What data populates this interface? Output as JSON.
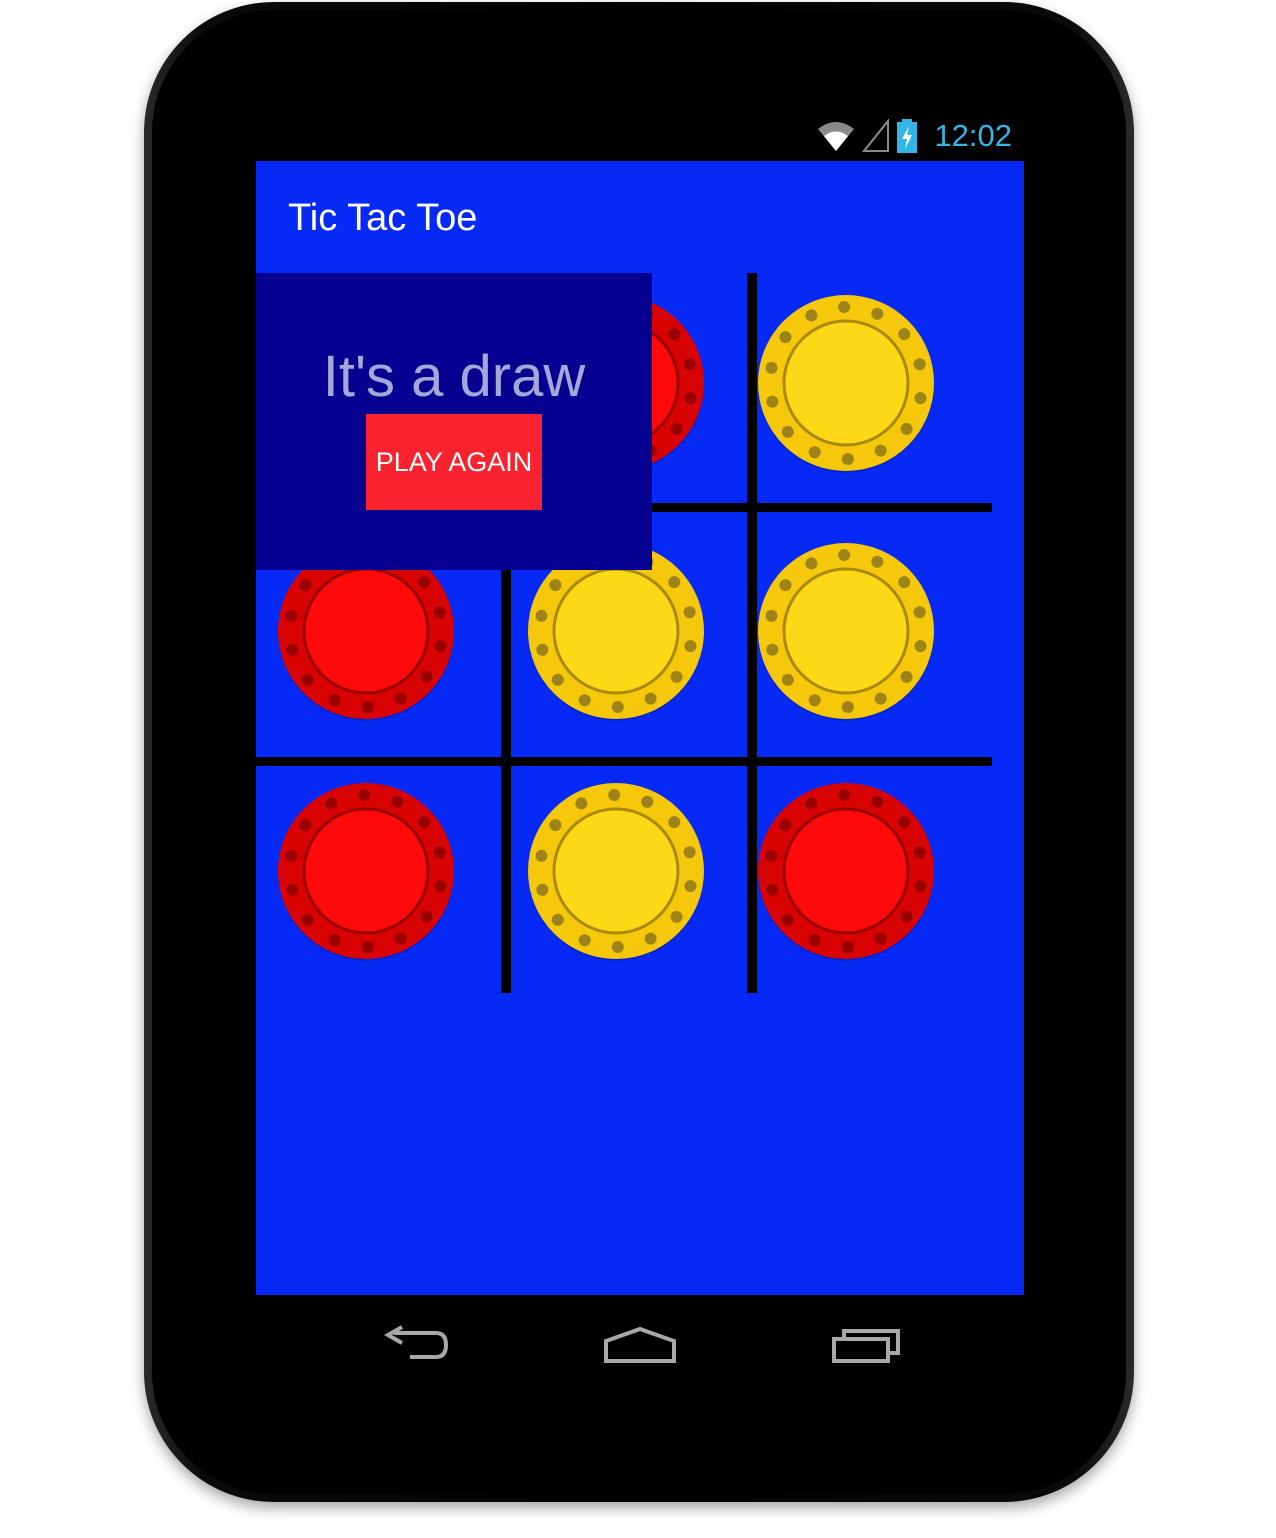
{
  "status_bar": {
    "time": "12:02",
    "icons": [
      "wifi-icon",
      "cell-signal-icon",
      "battery-charging-icon"
    ],
    "clock_color": "#33b5e5"
  },
  "app": {
    "title": "Tic Tac Toe",
    "background_color": "#0629f5"
  },
  "board": {
    "rows": [
      [
        "red",
        "red",
        "yellow"
      ],
      [
        "red",
        "yellow",
        "yellow"
      ],
      [
        "red",
        "yellow",
        "red"
      ]
    ],
    "colors": {
      "red": "#ff0a0a",
      "yellow": "#fdd816"
    }
  },
  "result_dialog": {
    "message": "It's a draw",
    "button_label": "PLAY AGAIN",
    "dialog_color": "#05008f",
    "button_color": "#f8232e"
  },
  "nav_bar": {
    "buttons": [
      "back-icon",
      "home-icon",
      "recent-apps-icon"
    ]
  }
}
